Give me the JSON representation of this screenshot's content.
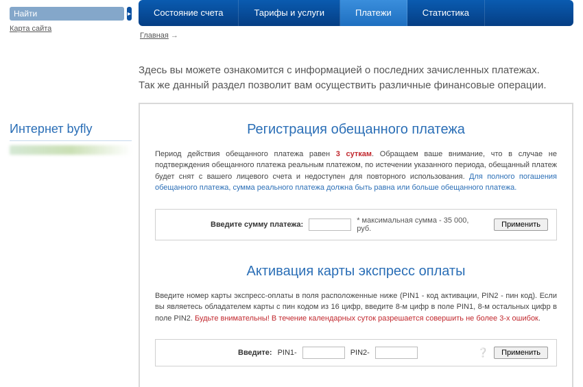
{
  "sidebar": {
    "search_placeholder": "Найти",
    "sitemap_label": "Карта сайта",
    "brand": "Интернет byfly"
  },
  "tabs": {
    "items": [
      {
        "label": "Состояние счета"
      },
      {
        "label": "Тарифы и услуги"
      },
      {
        "label": "Платежи"
      },
      {
        "label": "Статистика"
      }
    ],
    "active_index": 2
  },
  "breadcrumb": {
    "home": "Главная",
    "arrow": " →"
  },
  "intro": {
    "line1": "Здесь вы можете ознакомится с информацией о последних зачисленных платежах.",
    "line2": "Так же данный раздел позволит вам осуществить различные финансовые операции."
  },
  "section1": {
    "title": "Регистрация обещанного платежа",
    "desc_pre": "Период действия обещанного платежа равен ",
    "desc_red": "3 суткам",
    "desc_mid": ". Обращаем ваше внимание, что в случае не подтверждения обещанного платежа реальным платежом, по истечении указанного периода, обещанный платеж будет снят с вашего лицевого счета и недоступен для повторного использования. ",
    "desc_blue": "Для полного погашения обещанного платежа, сумма реального платежа должна быть равна или больше обещанного платежа.",
    "label": "Введите сумму платежа:",
    "maxnote": "* максимальная сумма - 35 000, руб.",
    "apply": "Применить"
  },
  "section2": {
    "title": "Активация карты экспресс оплаты",
    "desc_pre": "Введите номер карты экспресс-оплаты в поля расположенные ниже (PIN1 - код активации, PIN2 - пин код). Если вы являетесь обладателем карты с пин кодом из 16 цифр, введите 8-м цифр в поле PIN1, 8-м остальных цифр в поле PIN2. ",
    "desc_red": "Будьте внимательны! В течение календарных суток разрешается совершить не более 3-х ошибок",
    "desc_post": ".",
    "label": "Введите:",
    "pin1": "PIN1-",
    "pin2": "PIN2-",
    "apply": "Применить"
  }
}
